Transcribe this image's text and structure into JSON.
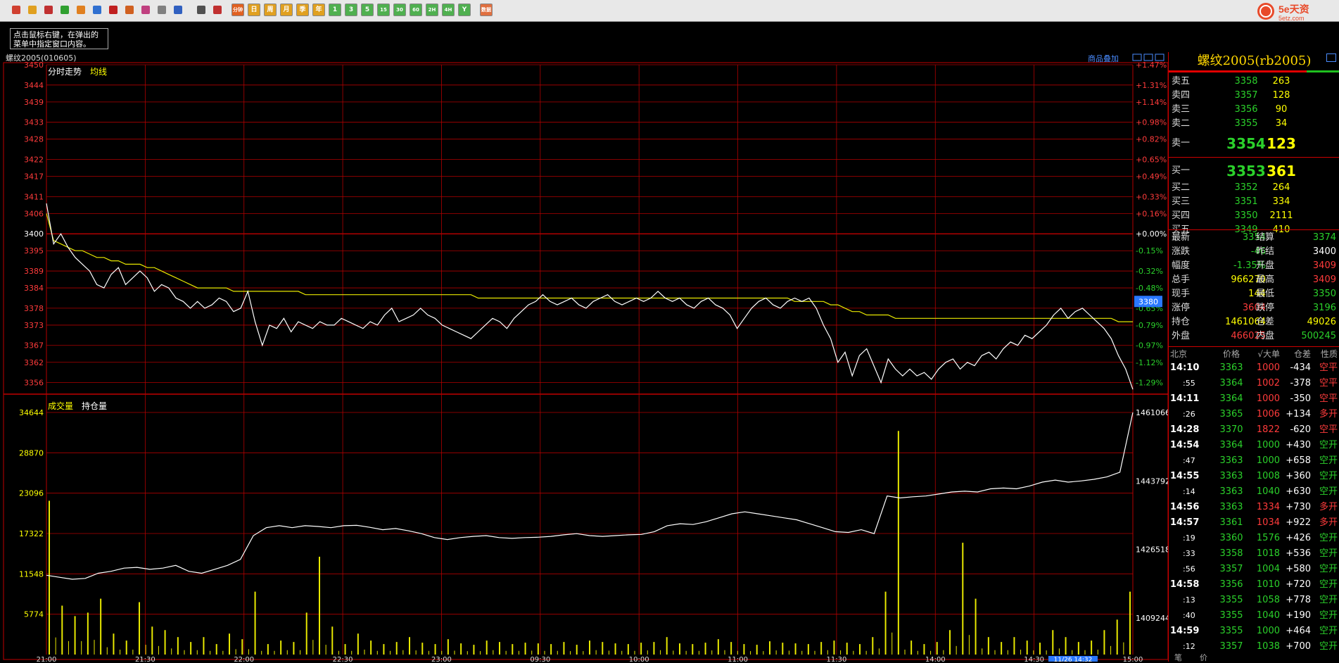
{
  "toolbar": {
    "icons": [
      "home-icon",
      "folder-icon",
      "news-icon",
      "refresh-icon",
      "search-icon",
      "search-alt-icon",
      "window-icon",
      "pen-icon",
      "tool-icon",
      "filter-icon",
      "indicator-icon",
      "table-icon",
      "trend-icon"
    ],
    "period_buttons": [
      "分钟",
      "日",
      "周",
      "月",
      "季",
      "年",
      "1",
      "3",
      "5",
      "15",
      "30",
      "60",
      "2H",
      "4H",
      "Y",
      "数据"
    ],
    "logo_text": "5e天资",
    "logo_sub": "5etz.com"
  },
  "tip": "点击鼠标右键，在弹出的菜单中指定窗口内容。",
  "chart_header": {
    "contract": "螺纹2005(010605)",
    "overlay_link": "商品叠加"
  },
  "chart_data": {
    "type": "line",
    "price_panel": {
      "title": "分时走势",
      "avg_label": "均线",
      "y_ticks": [
        3450,
        3444,
        3439,
        3433,
        3428,
        3422,
        3417,
        3411,
        3406,
        3400,
        3395,
        3389,
        3384,
        3378,
        3373,
        3367,
        3362,
        3356
      ],
      "pct_ticks": [
        "+1.47%",
        "+1.31%",
        "+1.14%",
        "+0.98%",
        "+0.82%",
        "+0.65%",
        "+0.49%",
        "+0.33%",
        "+0.16%",
        "+0.00%",
        "-0.15%",
        "-0.32%",
        "-0.48%",
        "-0.65%",
        "-0.79%",
        "-0.97%",
        "-1.12%",
        "-1.29%"
      ],
      "ylim": [
        3353,
        3450
      ],
      "prev_settle": 3400,
      "current_marker": "3380",
      "price": [
        3409,
        3397,
        3400,
        3396,
        3393,
        3391,
        3389,
        3385,
        3384,
        3388,
        3390,
        3385,
        3387,
        3389,
        3387,
        3383,
        3385,
        3384,
        3381,
        3380,
        3378,
        3380,
        3378,
        3379,
        3381,
        3380,
        3377,
        3378,
        3383,
        3374,
        3367,
        3373,
        3372,
        3375,
        3371,
        3374,
        3373,
        3372,
        3374,
        3373,
        3373,
        3375,
        3374,
        3373,
        3372,
        3374,
        3373,
        3376,
        3378,
        3374,
        3375,
        3376,
        3378,
        3376,
        3375,
        3373,
        3372,
        3371,
        3370,
        3369,
        3371,
        3373,
        3375,
        3374,
        3372,
        3375,
        3377,
        3379,
        3380,
        3382,
        3380,
        3379,
        3380,
        3381,
        3379,
        3378,
        3380,
        3381,
        3382,
        3380,
        3379,
        3380,
        3381,
        3380,
        3381,
        3383,
        3381,
        3380,
        3381,
        3379,
        3378,
        3380,
        3381,
        3379,
        3378,
        3376,
        3372,
        3375,
        3378,
        3380,
        3381,
        3379,
        3378,
        3380,
        3381,
        3380,
        3381,
        3378,
        3373,
        3369,
        3362,
        3365,
        3358,
        3364,
        3366,
        3361,
        3356,
        3363,
        3360,
        3358,
        3360,
        3358,
        3359,
        3357,
        3360,
        3362,
        3363,
        3360,
        3362,
        3361,
        3364,
        3365,
        3363,
        3366,
        3368,
        3367,
        3370,
        3369,
        3371,
        3373,
        3376,
        3378,
        3375,
        3377,
        3378,
        3376,
        3374,
        3372,
        3369,
        3364,
        3360,
        3354
      ],
      "avg": [
        3406,
        3398,
        3397,
        3396,
        3395,
        3395,
        3394,
        3393,
        3393,
        3392,
        3392,
        3391,
        3391,
        3391,
        3390,
        3390,
        3389,
        3388,
        3387,
        3386,
        3385,
        3384,
        3384,
        3384,
        3384,
        3384,
        3383,
        3383,
        3383,
        3383,
        3383,
        3383,
        3383,
        3383,
        3383,
        3383,
        3382,
        3382,
        3382,
        3382,
        3382,
        3382,
        3382,
        3382,
        3382,
        3382,
        3382,
        3382,
        3382,
        3382,
        3382,
        3382,
        3382,
        3382,
        3382,
        3382,
        3382,
        3382,
        3382,
        3382,
        3381,
        3381,
        3381,
        3381,
        3381,
        3381,
        3381,
        3381,
        3381,
        3381,
        3381,
        3381,
        3381,
        3381,
        3381,
        3381,
        3381,
        3381,
        3381,
        3381,
        3381,
        3381,
        3381,
        3381,
        3381,
        3381,
        3381,
        3381,
        3381,
        3381,
        3381,
        3381,
        3381,
        3381,
        3381,
        3381,
        3381,
        3381,
        3381,
        3381,
        3381,
        3381,
        3381,
        3381,
        3380,
        3380,
        3380,
        3380,
        3380,
        3379,
        3379,
        3378,
        3377,
        3377,
        3376,
        3376,
        3376,
        3376,
        3375,
        3375,
        3375,
        3375,
        3375,
        3375,
        3375,
        3375,
        3375,
        3375,
        3375,
        3375,
        3375,
        3375,
        3375,
        3375,
        3375,
        3375,
        3375,
        3375,
        3375,
        3375,
        3375,
        3375,
        3375,
        3375,
        3375,
        3375,
        3375,
        3375,
        3375,
        3374,
        3374,
        3374
      ]
    },
    "volume_panel": {
      "vol_label": "成交量",
      "oi_label": "持仓量",
      "vol_ticks": [
        34644,
        28870,
        23096,
        17322,
        11548,
        5774
      ],
      "oi_ticks": [
        1461066,
        1443792,
        1426518,
        1409244
      ],
      "oi_lim": [
        1400000,
        1461066
      ],
      "oi": [
        1420000,
        1419500,
        1419000,
        1419200,
        1420500,
        1421000,
        1421800,
        1422000,
        1421500,
        1421800,
        1422500,
        1421000,
        1420500,
        1421500,
        1422500,
        1424000,
        1430000,
        1432000,
        1432500,
        1432000,
        1432500,
        1432300,
        1432000,
        1432500,
        1432600,
        1432100,
        1431500,
        1431800,
        1431200,
        1430500,
        1429500,
        1429000,
        1429500,
        1429800,
        1430000,
        1429500,
        1429300,
        1429500,
        1429600,
        1429800,
        1430200,
        1430500,
        1430000,
        1429800,
        1430000,
        1430200,
        1430300,
        1431000,
        1432500,
        1433000,
        1432800,
        1433500,
        1434500,
        1435500,
        1436000,
        1435500,
        1435000,
        1434500,
        1434000,
        1433000,
        1432000,
        1431000,
        1430800,
        1431500,
        1430500,
        1440000,
        1439500,
        1439800,
        1440000,
        1440500,
        1441000,
        1441200,
        1441000,
        1441800,
        1442000,
        1441800,
        1442500,
        1443500,
        1444000,
        1443500,
        1443800,
        1444200,
        1444800,
        1446000,
        1461066
      ],
      "vol_max": 34644,
      "vol": [
        22000,
        7000,
        5500,
        6000,
        8000,
        3000,
        2000,
        7500,
        4000,
        3500,
        2500,
        1800,
        2500,
        1500,
        3000,
        2200,
        9000,
        1500,
        2000,
        1800,
        6000,
        14000,
        4000,
        1500,
        3000,
        2000,
        1500,
        1800,
        2500,
        1700,
        1500,
        2200,
        1600,
        1400,
        2000,
        1800,
        1500,
        1700,
        1600,
        1500,
        1800,
        1400,
        2000,
        1800,
        1600,
        1500,
        1700,
        1800,
        2500,
        1600,
        1500,
        1700,
        2200,
        1800,
        1500,
        1400,
        1900,
        1700,
        1600,
        1500,
        1800,
        2000,
        1700,
        1500,
        2500,
        9000,
        32000,
        2000,
        1500,
        1800,
        3500,
        16000,
        8000,
        2500,
        1800,
        2500,
        2000,
        1700,
        3500,
        2500,
        1800,
        2000,
        3500,
        5000,
        9000
      ]
    },
    "x_ticks": [
      "21:00",
      "21:30",
      "22:00",
      "22:30",
      "23:00",
      "09:30",
      "10:00",
      "11:00",
      "11:30",
      "14:00",
      "14:30",
      "15:00"
    ],
    "cursor_label": "11/26 14:32"
  },
  "panel": {
    "title": "螺纹2005(rb2005)",
    "asks": [
      {
        "label": "卖五",
        "price": "3358",
        "vol": "263"
      },
      {
        "label": "卖四",
        "price": "3357",
        "vol": "128"
      },
      {
        "label": "卖三",
        "price": "3356",
        "vol": "90"
      },
      {
        "label": "卖二",
        "price": "3355",
        "vol": "34"
      },
      {
        "label": "卖一",
        "price": "3354",
        "vol": "123"
      }
    ],
    "bids": [
      {
        "label": "买一",
        "price": "3353",
        "vol": "361"
      },
      {
        "label": "买二",
        "price": "3352",
        "vol": "264"
      },
      {
        "label": "买三",
        "price": "3351",
        "vol": "334"
      },
      {
        "label": "买四",
        "price": "3350",
        "vol": "2111"
      },
      {
        "label": "买五",
        "price": "3349",
        "vol": "410"
      }
    ],
    "quote": [
      {
        "l1": "最新",
        "v1": "3354",
        "c1": "green",
        "l2": "结算",
        "v2": "3374",
        "c2": "green"
      },
      {
        "l1": "涨跌",
        "v1": "-46",
        "c1": "green",
        "l2": "昨结",
        "v2": "3400",
        "c2": "white"
      },
      {
        "l1": "幅度",
        "v1": "-1.35%",
        "c1": "green",
        "l2": "开盘",
        "v2": "3409",
        "c2": "red"
      },
      {
        "l1": "总手",
        "v1": "966270",
        "c1": "yellow",
        "l2": "最高",
        "v2": "3409",
        "c2": "red"
      },
      {
        "l1": "现手",
        "v1": "144",
        "c1": "yellow",
        "l2": "最低",
        "v2": "3350",
        "c2": "green"
      },
      {
        "l1": "涨停",
        "v1": "3604",
        "c1": "red",
        "l2": "跌停",
        "v2": "3196",
        "c2": "green"
      },
      {
        "l1": "持仓",
        "v1": "1461064",
        "c1": "yellow",
        "l2": "仓差",
        "v2": "49026",
        "c2": "yellow"
      },
      {
        "l1": "外盘",
        "v1": "466025",
        "c1": "red",
        "l2": "内盘",
        "v2": "500245",
        "c2": "green"
      }
    ],
    "ticks_header": [
      "北京",
      "价格",
      "√大单",
      "仓差",
      "性质"
    ],
    "ticks": [
      {
        "time": "14:10",
        "price": "3363",
        "vol": "1000",
        "diff": "-434",
        "type": "空平",
        "bold": true,
        "vc": "red",
        "tc": "red"
      },
      {
        "time": ":55",
        "price": "3364",
        "vol": "1002",
        "diff": "-378",
        "type": "空平",
        "bold": false,
        "vc": "red",
        "tc": "red"
      },
      {
        "time": "14:11",
        "price": "3364",
        "vol": "1000",
        "diff": "-350",
        "type": "空平",
        "bold": true,
        "vc": "red",
        "tc": "red"
      },
      {
        "time": ":26",
        "price": "3365",
        "vol": "1006",
        "diff": "+134",
        "type": "多开",
        "bold": false,
        "vc": "red",
        "tc": "red"
      },
      {
        "time": "14:28",
        "price": "3370",
        "vol": "1822",
        "diff": "-620",
        "type": "空平",
        "bold": true,
        "vc": "red",
        "tc": "red"
      },
      {
        "time": "14:54",
        "price": "3364",
        "vol": "1000",
        "diff": "+430",
        "type": "空开",
        "bold": true,
        "vc": "green",
        "tc": "green"
      },
      {
        "time": ":47",
        "price": "3363",
        "vol": "1000",
        "diff": "+658",
        "type": "空开",
        "bold": false,
        "vc": "green",
        "tc": "green"
      },
      {
        "time": "14:55",
        "price": "3363",
        "vol": "1008",
        "diff": "+360",
        "type": "空开",
        "bold": true,
        "vc": "green",
        "tc": "green"
      },
      {
        "time": ":14",
        "price": "3363",
        "vol": "1040",
        "diff": "+630",
        "type": "空开",
        "bold": false,
        "vc": "green",
        "tc": "green"
      },
      {
        "time": "14:56",
        "price": "3363",
        "vol": "1334",
        "diff": "+730",
        "type": "多开",
        "bold": true,
        "vc": "red",
        "tc": "red"
      },
      {
        "time": "14:57",
        "price": "3361",
        "vol": "1034",
        "diff": "+922",
        "type": "多开",
        "bold": true,
        "vc": "red",
        "tc": "red"
      },
      {
        "time": ":19",
        "price": "3360",
        "vol": "1576",
        "diff": "+426",
        "type": "空开",
        "bold": false,
        "vc": "green",
        "tc": "green"
      },
      {
        "time": ":33",
        "price": "3358",
        "vol": "1018",
        "diff": "+536",
        "type": "空开",
        "bold": false,
        "vc": "green",
        "tc": "green"
      },
      {
        "time": ":56",
        "price": "3357",
        "vol": "1004",
        "diff": "+580",
        "type": "空开",
        "bold": false,
        "vc": "green",
        "tc": "green"
      },
      {
        "time": "14:58",
        "price": "3356",
        "vol": "1010",
        "diff": "+720",
        "type": "空开",
        "bold": true,
        "vc": "green",
        "tc": "green"
      },
      {
        "time": ":13",
        "price": "3355",
        "vol": "1058",
        "diff": "+778",
        "type": "空开",
        "bold": false,
        "vc": "green",
        "tc": "green"
      },
      {
        "time": ":40",
        "price": "3355",
        "vol": "1040",
        "diff": "+190",
        "type": "空开",
        "bold": false,
        "vc": "green",
        "tc": "green"
      },
      {
        "time": "14:59",
        "price": "3355",
        "vol": "1000",
        "diff": "+464",
        "type": "空开",
        "bold": true,
        "vc": "green",
        "tc": "green"
      },
      {
        "time": ":12",
        "price": "3357",
        "vol": "1038",
        "diff": "+700",
        "type": "空开",
        "bold": false,
        "vc": "green",
        "tc": "green"
      }
    ],
    "bottom_tabs": [
      "笔",
      "价"
    ]
  }
}
